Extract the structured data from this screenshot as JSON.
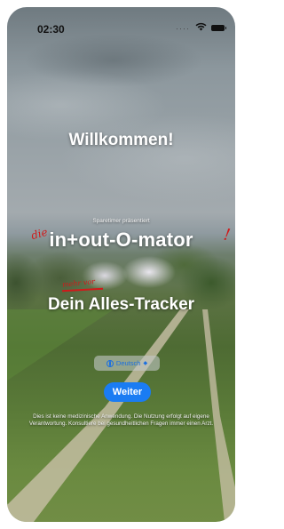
{
  "status_bar": {
    "time": "02:30",
    "signal": "····"
  },
  "welcome": {
    "title": "Willkommen!"
  },
  "brand": {
    "presenter": "Sparetimer präsentiert",
    "app_name": "in+out-O-mator",
    "scribble_prefix": "die",
    "scribble_suffix": "!",
    "scribble_tag": "mehr vor",
    "tagline": "Dein Alles-Tracker"
  },
  "language": {
    "selected": "Deutsch",
    "icon": "globe-icon"
  },
  "actions": {
    "next_label": "Weiter"
  },
  "disclaimer": "Dies ist keine medizinische Anwendung. Die Nutzung erfolgt auf eigene Verantwortung. Konsultiere bei gesundheitlichen Fragen immer einen Arzt.",
  "colors": {
    "accent": "#1a7cf3",
    "scribble": "#d01a1a"
  }
}
